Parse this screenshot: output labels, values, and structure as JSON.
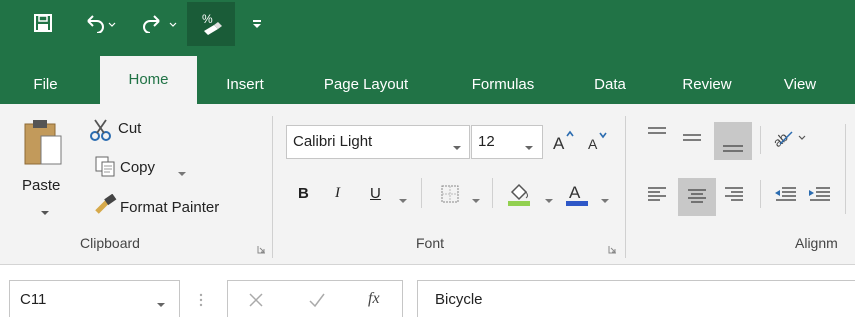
{
  "quick_access": {
    "icons": [
      "save-icon",
      "undo-icon",
      "redo-icon",
      "percent-format-icon",
      "customize-qat-icon"
    ]
  },
  "tabs": [
    {
      "label": "File"
    },
    {
      "label": "Home"
    },
    {
      "label": "Insert"
    },
    {
      "label": "Page Layout"
    },
    {
      "label": "Formulas"
    },
    {
      "label": "Data"
    },
    {
      "label": "Review"
    },
    {
      "label": "View"
    }
  ],
  "active_tab": "Home",
  "clipboard": {
    "paste_label": "Paste",
    "cut_label": "Cut",
    "copy_label": "Copy",
    "format_painter_label": "Format Painter",
    "group_label": "Clipboard"
  },
  "font": {
    "font_name": "Calibri Light",
    "font_size": "12",
    "bold": "B",
    "italic": "I",
    "underline": "U",
    "group_label": "Font",
    "fill_color": "#92d050",
    "font_color": "#2e57c7"
  },
  "alignment": {
    "group_label": "Alignm"
  },
  "formula_bar": {
    "name_box": "C11",
    "formula_value": "Bicycle",
    "fx_label": "fx"
  },
  "colors": {
    "accent": "#217346"
  }
}
